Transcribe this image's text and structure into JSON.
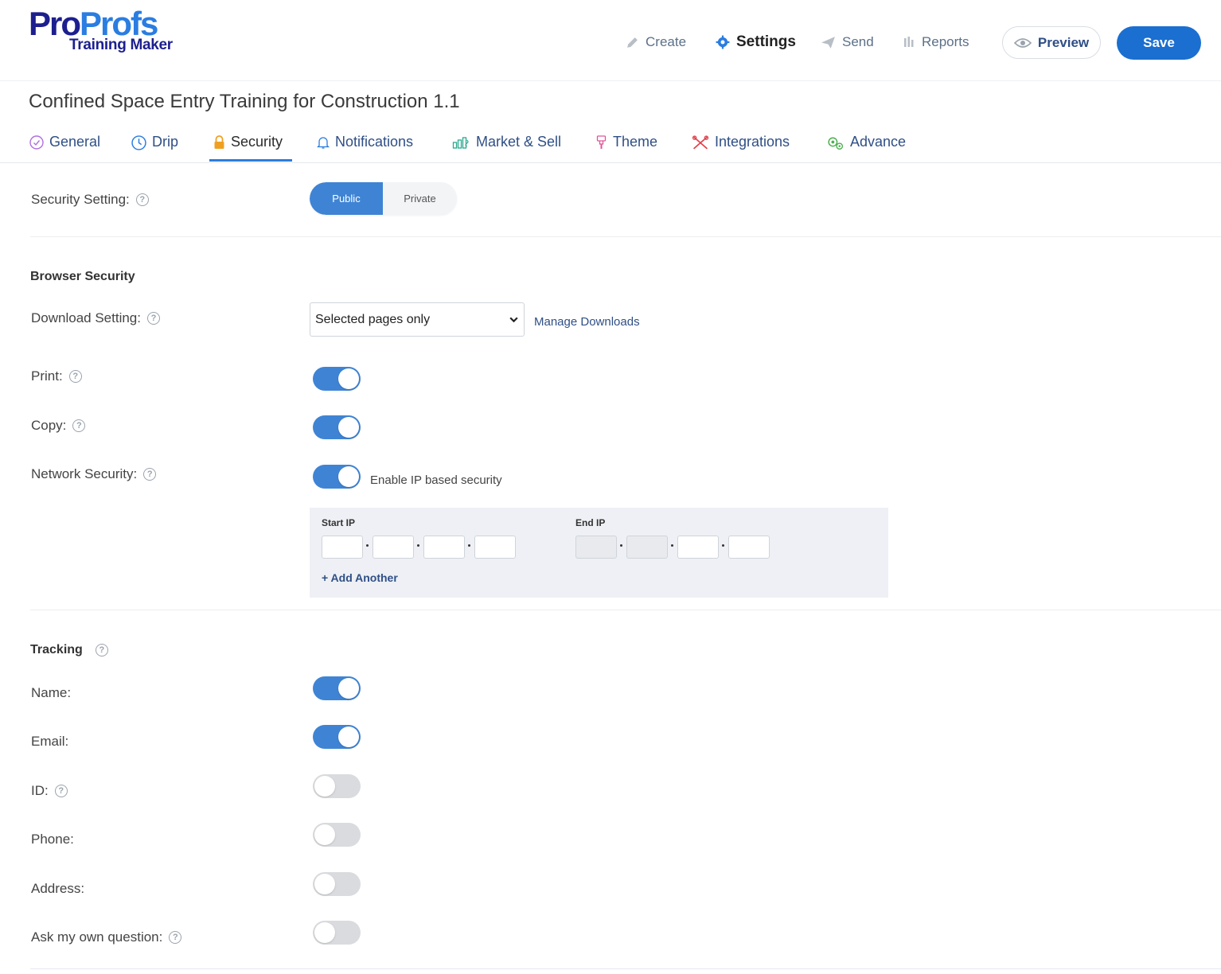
{
  "brand": {
    "logo_pro": "Pro",
    "logo_profs": "Profs",
    "logo_sub": "Training Maker"
  },
  "topnav": {
    "create": "Create",
    "settings": "Settings",
    "send": "Send",
    "reports": "Reports",
    "preview": "Preview",
    "save": "Save"
  },
  "page_title": "Confined Space Entry Training for Construction 1.1",
  "tabs": {
    "general": "General",
    "drip": "Drip",
    "security": "Security",
    "notifications": "Notifications",
    "market_sell": "Market & Sell",
    "theme": "Theme",
    "integrations": "Integrations",
    "advance": "Advance"
  },
  "security_setting": {
    "label": "Security Setting:",
    "public": "Public",
    "private": "Private",
    "selected": "Public"
  },
  "browser_security": {
    "title": "Browser Security",
    "download_label": "Download Setting:",
    "download_value": "Selected pages only",
    "manage_downloads": "Manage Downloads",
    "print_label": "Print:",
    "print_on": true,
    "copy_label": "Copy:",
    "copy_on": true,
    "network_label": "Network Security:",
    "network_on": true,
    "network_note": "Enable IP based security",
    "start_ip": "Start IP",
    "end_ip": "End IP",
    "add_another": "+ Add Another"
  },
  "tracking": {
    "title": "Tracking",
    "name_label": "Name:",
    "name_on": true,
    "email_label": "Email:",
    "email_on": true,
    "id_label": "ID:",
    "id_on": false,
    "phone_label": "Phone:",
    "phone_on": false,
    "address_label": "Address:",
    "address_on": false,
    "question_label": "Ask my own question:",
    "question_on": false
  },
  "colors": {
    "accent": "#3f84d4",
    "save": "#1a6fd0",
    "link": "#2f4f86",
    "brand_dark": "#1d1f8f",
    "brand_light": "#2a7de1"
  }
}
